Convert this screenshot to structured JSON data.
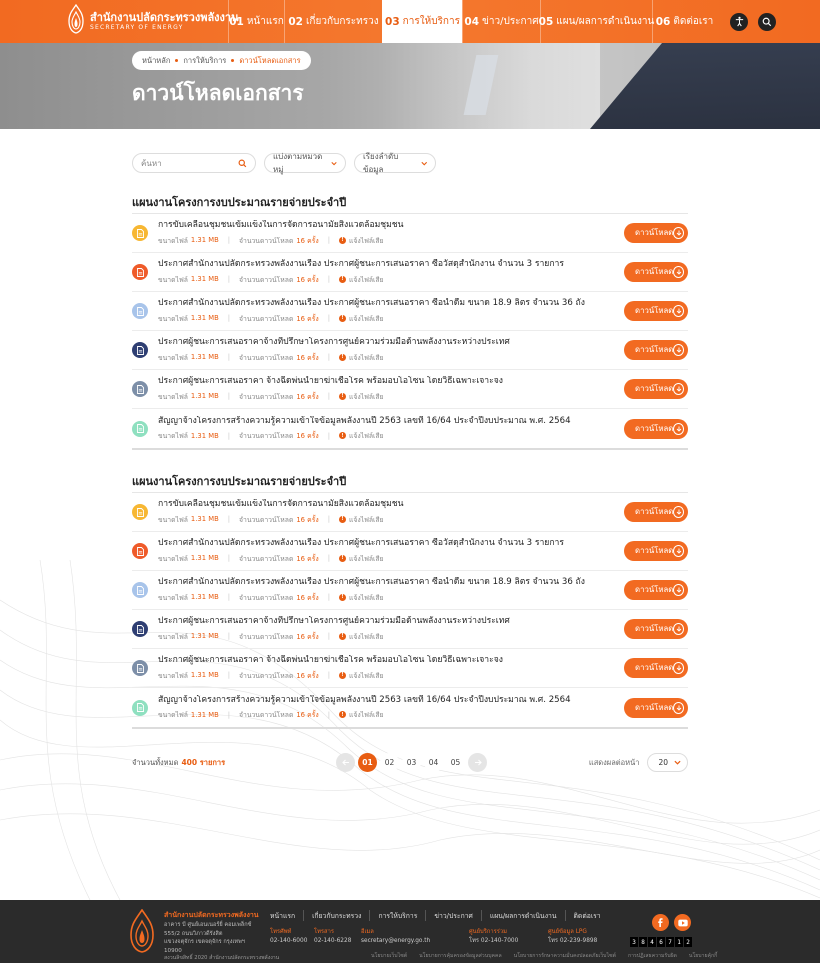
{
  "header": {
    "org_th": "สำนักงานปลัดกระทรวงพลังงาน",
    "org_en": "SECRETARY OF ENERGY",
    "nav": [
      {
        "num": "01",
        "label": "หน้าแรก",
        "active": false,
        "width": 56
      },
      {
        "num": "02",
        "label": "เกี่ยวกับกระทรวง",
        "active": false,
        "width": 98
      },
      {
        "num": "03",
        "label": "การให้บริการ",
        "active": true,
        "width": 80
      },
      {
        "num": "04",
        "label": "ข่าว/ประกาศ",
        "active": false,
        "width": 78
      },
      {
        "num": "05",
        "label": "แผน/ผลการดำเนินงาน",
        "active": false,
        "width": 112
      },
      {
        "num": "06",
        "label": "ติดต่อเรา",
        "active": false,
        "width": 64
      }
    ]
  },
  "hero": {
    "breadcrumb": [
      "หน้าหลัก",
      "การให้บริการ",
      "ดาวน์โหลดเอกสาร"
    ],
    "title": "ดาวน์โหลดเอกสาร"
  },
  "filters": {
    "search_placeholder": "ค้นหา",
    "category_label": "แบ่งตามหมวดหมู่",
    "sort_label": "เรียงลำดับข้อมูล"
  },
  "labels": {
    "size": "ขนาดไฟล์",
    "count": "จำนวนดาวน์โหลด",
    "report": "แจ้งไฟล์เสีย",
    "download": "ดาวน์โหลด"
  },
  "sections": [
    {
      "title": "แผนงานโครงการงบประมาณรายจ่ายประจำปี",
      "files": [
        {
          "name": "การขับเคลื่อนชุมชนเข้มแข็งในการจัดการอนามัยสิ่งแวดล้อมชุมชน",
          "size": "1.31 MB",
          "downloads": "16 ครั้ง",
          "icon_color": "#f7b733",
          "icon": "document-icon"
        },
        {
          "name": "ประกาศสำนักงานปลัดกระทรวงพลังงานเรื่อง ประกาศผู้ชนะการเสนอราคา ซื้อวัสดุสำนักงาน จำนวน 3 รายการ",
          "size": "1.31 MB",
          "downloads": "16 ครั้ง",
          "icon_color": "#ef5b2a",
          "icon": "document-icon"
        },
        {
          "name": "ประกาศสำนักงานปลัดกระทรวงพลังงานเรื่อง ประกาศผู้ชนะการเสนอราคา ซื้อน้ำดื่ม ขนาด 18.9 ลิตร จำนวน 36 ถัง",
          "size": "1.31 MB",
          "downloads": "16 ครั้ง",
          "icon_color": "#a8c4ea",
          "icon": "document-icon"
        },
        {
          "name": "ประกาศผู้ชนะการเสนอราคาจ้างที่ปรึกษาโครงการศูนย์ความร่วมมือด้านพลังงานระหว่างประเทศ",
          "size": "1.31 MB",
          "downloads": "16 ครั้ง",
          "icon_color": "#2f3f73",
          "icon": "document-icon"
        },
        {
          "name": "ประกาศผู้ชนะการเสนอราคา จ้างฉีดพ่นน้ำยาฆ่าเชื้อโรค พร้อมอบโอโซน โดยวิธีเฉพาะเจาะจง",
          "size": "1.31 MB",
          "downloads": "16 ครั้ง",
          "icon_color": "#7d8fa8",
          "icon": "document-icon"
        },
        {
          "name": "สัญญาจ้างโครงการสร้างความรู้ความเข้าใจข้อมูลพลังงานปี 2563 เลขที่ 16/64 ประจำปีงบประมาณ พ.ศ. 2564",
          "size": "1.31 MB",
          "downloads": "16 ครั้ง",
          "icon_color": "#8fe0c0",
          "icon": "document-icon"
        }
      ]
    },
    {
      "title": "แผนงานโครงการงบประมาณรายจ่ายประจำปี",
      "files": [
        {
          "name": "การขับเคลื่อนชุมชนเข้มแข็งในการจัดการอนามัยสิ่งแวดล้อมชุมชน",
          "size": "1.31 MB",
          "downloads": "16 ครั้ง",
          "icon_color": "#f7b733",
          "icon": "document-icon"
        },
        {
          "name": "ประกาศสำนักงานปลัดกระทรวงพลังงานเรื่อง ประกาศผู้ชนะการเสนอราคา ซื้อวัสดุสำนักงาน จำนวน 3 รายการ",
          "size": "1.31 MB",
          "downloads": "16 ครั้ง",
          "icon_color": "#ef5b2a",
          "icon": "document-icon"
        },
        {
          "name": "ประกาศสำนักงานปลัดกระทรวงพลังงานเรื่อง ประกาศผู้ชนะการเสนอราคา ซื้อน้ำดื่ม ขนาด 18.9 ลิตร จำนวน 36 ถัง",
          "size": "1.31 MB",
          "downloads": "16 ครั้ง",
          "icon_color": "#a8c4ea",
          "icon": "document-icon"
        },
        {
          "name": "ประกาศผู้ชนะการเสนอราคาจ้างที่ปรึกษาโครงการศูนย์ความร่วมมือด้านพลังงานระหว่างประเทศ",
          "size": "1.31 MB",
          "downloads": "16 ครั้ง",
          "icon_color": "#2f3f73",
          "icon": "document-icon"
        },
        {
          "name": "ประกาศผู้ชนะการเสนอราคา จ้างฉีดพ่นน้ำยาฆ่าเชื้อโรค พร้อมอบโอโซน โดยวิธีเฉพาะเจาะจง",
          "size": "1.31 MB",
          "downloads": "16 ครั้ง",
          "icon_color": "#7d8fa8",
          "icon": "document-icon"
        },
        {
          "name": "สัญญาจ้างโครงการสร้างความรู้ความเข้าใจข้อมูลพลังงานปี 2563 เลขที่ 16/64 ประจำปีงบประมาณ พ.ศ. 2564",
          "size": "1.31 MB",
          "downloads": "16 ครั้ง",
          "icon_color": "#8fe0c0",
          "icon": "document-icon"
        }
      ]
    }
  ],
  "pagination": {
    "total_label": "จำนวนทั้งหมด",
    "total_value": "400 รายการ",
    "pages": [
      "01",
      "02",
      "03",
      "04",
      "05"
    ],
    "current": "01",
    "per_page_label": "แสดงผลต่อหน้า",
    "per_page_value": "20"
  },
  "footer": {
    "org_name": "สำนักงานปลัดกระทรวงพลังงาน",
    "address": [
      "อาคาร บี ศูนย์เอนเนอร์ยี่ คอมเพล็กซ์",
      "555/2 ถนนวิภาวดีรังสิต",
      "แขวงจตุจักร เขตจตุจักร กรุงเทพฯ 10900"
    ],
    "copyright": "สงวนลิขสิทธิ์ 2020 สำนักงานปลัดกระทรวงพลังงาน",
    "nav": [
      "หน้าแรก",
      "เกี่ยวกับกระทรวง",
      "การให้บริการ",
      "ข่าว/ประกาศ",
      "แผน/ผลการดำเนินงาน",
      "ติดต่อเรา"
    ],
    "contacts": [
      {
        "label": "โทรศัพท์",
        "value": "02-140-6000"
      },
      {
        "label": "โทรสาร",
        "value": "02-140-6228"
      },
      {
        "label": "อีเมล",
        "value": "secretary@energy.go.th"
      },
      {
        "label": "ศูนย์บริการร่วม",
        "value": "โทร 02-140-7000"
      },
      {
        "label": "ศูนย์ข้อมูล LPG",
        "value": "โทร 02-239-9898"
      }
    ],
    "counter": [
      "3",
      "8",
      "4",
      "6",
      "7",
      "1",
      "2"
    ],
    "links": [
      "นโยบายเว็บไซต์",
      "นโยบายการคุ้มครองข้อมูลส่วนบุคคล",
      "นโยบายการรักษาความมั่นคงปลอดภัยเว็บไซต์",
      "การปฏิเสธความรับผิด",
      "นโยบายคุ้กกี้"
    ]
  }
}
